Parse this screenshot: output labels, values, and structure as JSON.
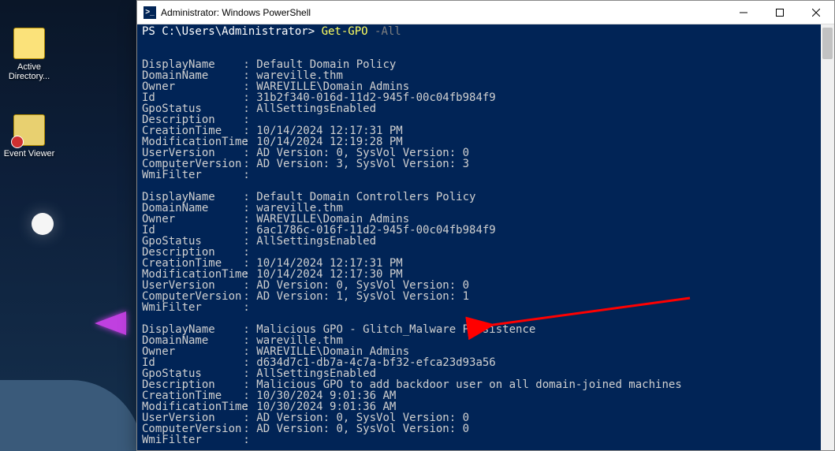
{
  "desktop": {
    "icons": {
      "ad_label": "Active\nDirectory...",
      "ev_label": "Event Viewer"
    }
  },
  "window": {
    "title": "Administrator: Windows PowerShell",
    "icon_glyph": ">_"
  },
  "prompt": {
    "path": "PS C:\\Users\\Administrator> ",
    "command": "Get-GPO",
    "flag": " -All"
  },
  "field_labels": {
    "DisplayName": "DisplayName",
    "DomainName": "DomainName",
    "Owner": "Owner",
    "Id": "Id",
    "GpoStatus": "GpoStatus",
    "Description": "Description",
    "CreationTime": "CreationTime",
    "ModificationTime": "ModificationTime",
    "UserVersion": "UserVersion",
    "ComputerVersion": "ComputerVersion",
    "WmiFilter": "WmiFilter"
  },
  "gpos": [
    {
      "DisplayName": "Default Domain Policy",
      "DomainName": "wareville.thm",
      "Owner": "WAREVILLE\\Domain Admins",
      "Id": "31b2f340-016d-11d2-945f-00c04fb984f9",
      "GpoStatus": "AllSettingsEnabled",
      "Description": "",
      "CreationTime": "10/14/2024 12:17:31 PM",
      "ModificationTime": "10/14/2024 12:19:28 PM",
      "UserVersion": "AD Version: 0, SysVol Version: 0",
      "ComputerVersion": "AD Version: 3, SysVol Version: 3",
      "WmiFilter": ""
    },
    {
      "DisplayName": "Default Domain Controllers Policy",
      "DomainName": "wareville.thm",
      "Owner": "WAREVILLE\\Domain Admins",
      "Id": "6ac1786c-016f-11d2-945f-00c04fb984f9",
      "GpoStatus": "AllSettingsEnabled",
      "Description": "",
      "CreationTime": "10/14/2024 12:17:31 PM",
      "ModificationTime": "10/14/2024 12:17:30 PM",
      "UserVersion": "AD Version: 0, SysVol Version: 0",
      "ComputerVersion": "AD Version: 1, SysVol Version: 1",
      "WmiFilter": ""
    },
    {
      "DisplayName": "Malicious GPO - Glitch_Malware Persistence",
      "DomainName": "wareville.thm",
      "Owner": "WAREVILLE\\Domain Admins",
      "Id": "d634d7c1-db7a-4c7a-bf32-efca23d93a56",
      "GpoStatus": "AllSettingsEnabled",
      "Description": "Malicious GPO to add backdoor user on all domain-joined machines",
      "CreationTime": "10/30/2024 9:01:36 AM",
      "ModificationTime": "10/30/2024 9:01:36 AM",
      "UserVersion": "AD Version: 0, SysVol Version: 0",
      "ComputerVersion": "AD Version: 0, SysVol Version: 0",
      "WmiFilter": ""
    }
  ]
}
